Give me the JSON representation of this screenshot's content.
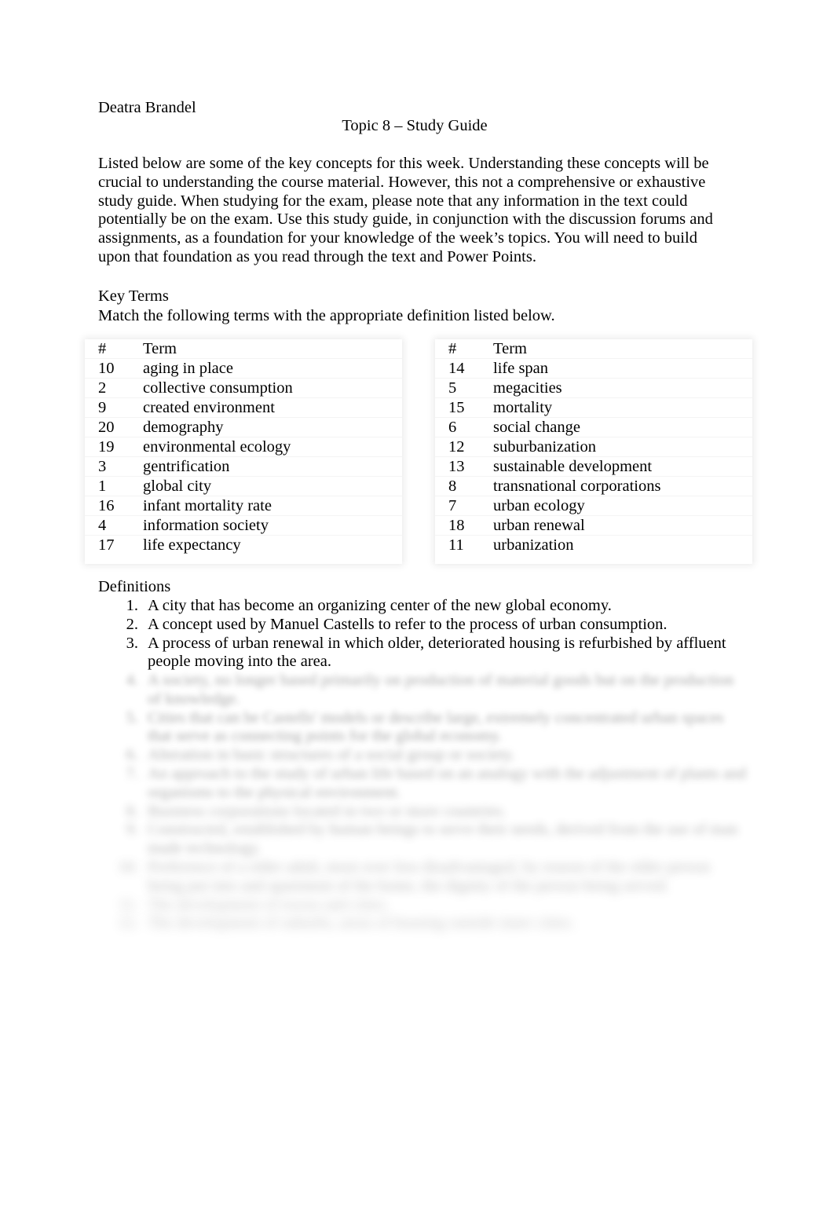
{
  "document": {
    "author": "Deatra Brandel",
    "title": "Topic 8 – Study Guide",
    "intro": "Listed below are some of the key concepts for this week. Understanding these concepts will be crucial to understanding the course material. However, this not a comprehensive or exhaustive study guide. When studying for the exam, please note that any information in the text could potentially be on the exam. Use this study guide, in conjunction with the discussion forums and assignments, as a foundation for your knowledge of the week’s topics. You will need to build upon that foundation as you read through the text and Power Points."
  },
  "key_terms": {
    "heading": "Key Terms",
    "instruction": "Match the following terms with the appropriate definition listed below.",
    "columns": [
      "#",
      "Term"
    ],
    "left_table": [
      {
        "num": "#",
        "term": "Term"
      },
      {
        "num": "10",
        "term": "aging in place"
      },
      {
        "num": "2",
        "term": "collective consumption"
      },
      {
        "num": "9",
        "term": "created environment"
      },
      {
        "num": "20",
        "term": "demography"
      },
      {
        "num": "19",
        "term": "environmental ecology"
      },
      {
        "num": "3",
        "term": "gentrification"
      },
      {
        "num": "1",
        "term": "global city"
      },
      {
        "num": "16",
        "term": "infant mortality rate"
      },
      {
        "num": "4",
        "term": "information society"
      },
      {
        "num": "17",
        "term": "life expectancy"
      }
    ],
    "right_table": [
      {
        "num": "#",
        "term": "Term"
      },
      {
        "num": "14",
        "term": "life span"
      },
      {
        "num": "5",
        "term": "megacities"
      },
      {
        "num": "15",
        "term": "mortality"
      },
      {
        "num": "6",
        "term": "social change"
      },
      {
        "num": "12",
        "term": "suburbanization"
      },
      {
        "num": "13",
        "term": "sustainable development"
      },
      {
        "num": "8",
        "term": "transnational corporations"
      },
      {
        "num": "7",
        "term": "urban ecology"
      },
      {
        "num": "18",
        "term": "urban renewal"
      },
      {
        "num": "11",
        "term": "urbanization"
      }
    ]
  },
  "definitions": {
    "heading": "Definitions",
    "items": [
      {
        "marker": "1.",
        "text": "A city that has become an organizing center of the new global economy."
      },
      {
        "marker": "2.",
        "text": "A concept used by Manuel Castells to refer to the process of urban consumption."
      },
      {
        "marker": "3.",
        "text": "A process of urban renewal in which older, deteriorated housing is refurbished by affluent people moving into the area."
      }
    ],
    "obscured_items": [
      {
        "marker": "4.",
        "text": "A society, no longer based primarily on production of material goods but on the production of knowledge."
      },
      {
        "marker": "5.",
        "text": "Cities that can be Castells' models or describe large, extremely concentrated urban spaces that serve as connecting points for the global economy."
      },
      {
        "marker": "6.",
        "text": "Alteration in basic structures of a social group or society."
      },
      {
        "marker": "7.",
        "text": "An approach to the study of urban life based on an analogy with the adjustment of plants and organisms to the physical environment."
      },
      {
        "marker": "8.",
        "text": "Business corporations located in two or more countries."
      },
      {
        "marker": "9.",
        "text": "Constructed, established by human beings to serve their needs, derived from the use of man made technology."
      },
      {
        "marker": "10.",
        "text": "Preference of a older adult, most over less disadvantaged, by reason of the older person being put into and apartment of the home, the dignity of the person being served."
      },
      {
        "marker": "11.",
        "text": "The development of towns and cities."
      },
      {
        "marker": "12.",
        "text": "The development of suburbs, areas of housing outside inner cities."
      }
    ]
  }
}
